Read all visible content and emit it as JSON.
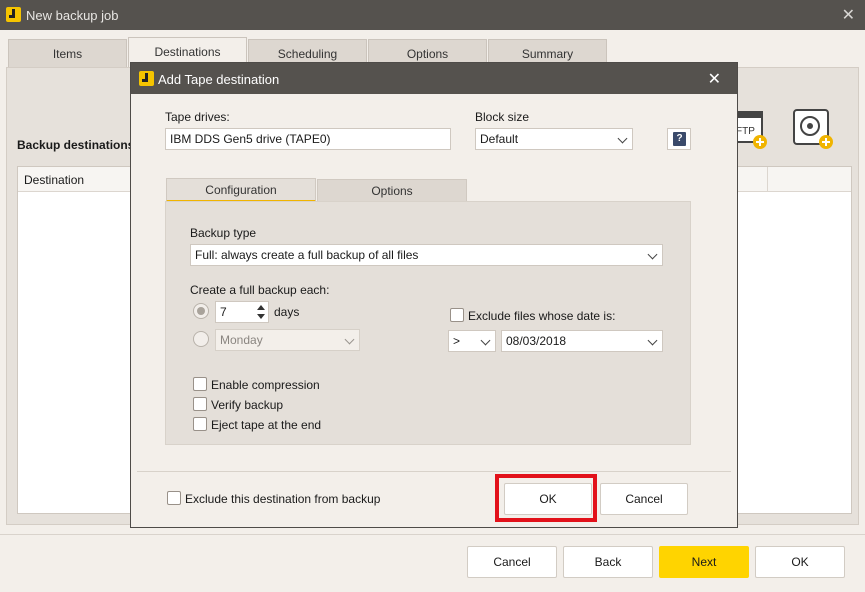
{
  "window": {
    "title": "New backup job",
    "close_label": "✕"
  },
  "tabs": [
    "Items",
    "Destinations",
    "Scheduling",
    "Options",
    "Summary"
  ],
  "main": {
    "backup_destinations_label": "Backup destinations",
    "column_destination": "Destination",
    "icons": [
      "ftp-destination-icon",
      "tape-destination-icon"
    ],
    "ftp_label": "FTP"
  },
  "footer": {
    "cancel": "Cancel",
    "back": "Back",
    "next": "Next",
    "ok": "OK"
  },
  "dialog": {
    "title": "Add Tape destination",
    "close_label": "✕",
    "tape_drives_label": "Tape drives:",
    "tape_drive_value": "IBM DDS Gen5 drive (TAPE0)",
    "block_size_label": "Block size",
    "block_size_value": "Default",
    "help_label": "?",
    "tabs": [
      "Configuration",
      "Options"
    ],
    "backup_type_label": "Backup type",
    "backup_type_value": "Full: always create a full backup of all files",
    "full_backup_each_label": "Create a full backup each:",
    "days_value": "7",
    "days_label": "days",
    "weekday_value": "Monday",
    "exclude_date_label": "Exclude files whose date is:",
    "operator_value": ">",
    "date_value": "08/03/2018",
    "enable_compression": "Enable compression",
    "verify_backup": "Verify backup",
    "eject_tape": "Eject tape at the end",
    "exclude_destination": "Exclude this destination from backup",
    "ok": "OK",
    "cancel": "Cancel"
  },
  "colors": {
    "titlebar": "#55524e",
    "accent": "#ffd400",
    "highlight": "#e2111a"
  }
}
